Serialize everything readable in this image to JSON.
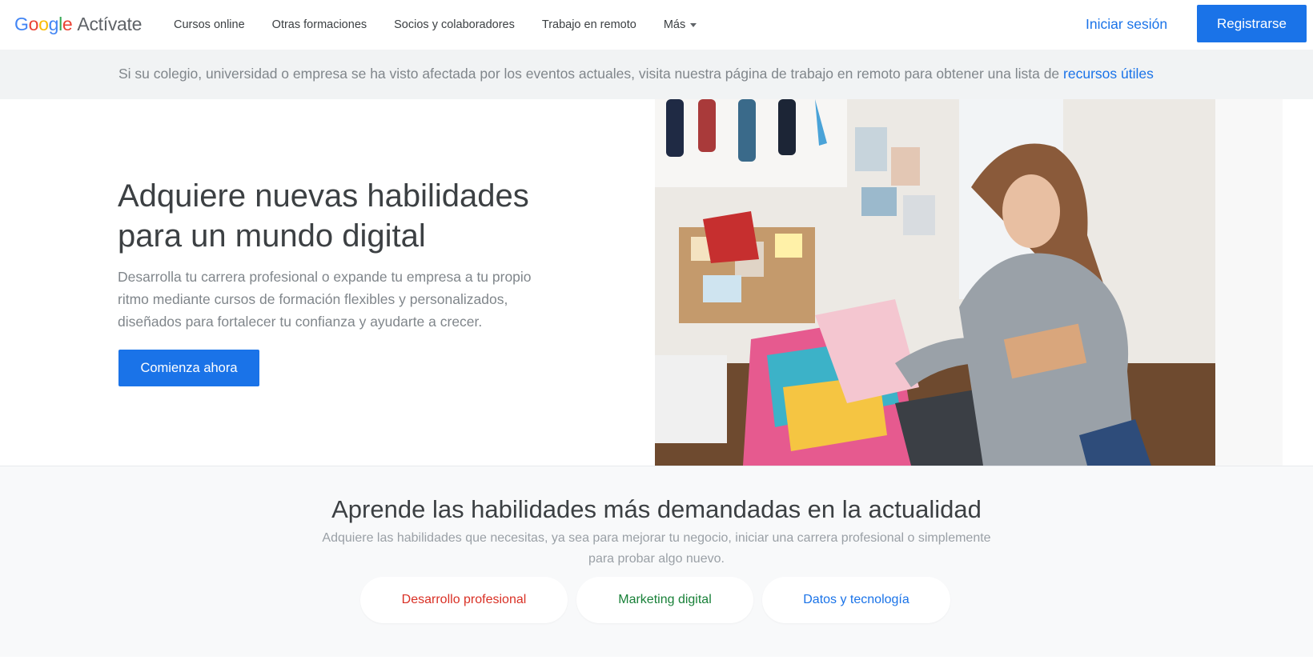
{
  "header": {
    "logo": {
      "g1": "G",
      "o1": "o",
      "o2": "o",
      "g2": "g",
      "l": "l",
      "e": "e",
      "product": "Actívate"
    },
    "nav": [
      "Cursos online",
      "Otras formaciones",
      "Socios y colaboradores",
      "Trabajo en remoto",
      "Más"
    ],
    "more_icon": "caret-down-icon",
    "login_label": "Iniciar sesión",
    "register_label": "Registrarse"
  },
  "notice": {
    "text": "Si su colegio, universidad o empresa se ha visto afectada por los eventos actuales, visita nuestra página de trabajo en remoto para obtener una lista de ",
    "link": "recursos útiles"
  },
  "hero": {
    "title": "Adquiere nuevas habilidades para un mundo digital",
    "description": "Desarrolla tu carrera profesional o expande tu empresa a tu propio ritmo mediante cursos de formación flexibles y personalizados, diseñados para fortalecer tu confianza y ayudarte a crecer.",
    "cta_label": "Comienza ahora"
  },
  "skills": {
    "title": "Aprende las habilidades más demandadas en la actualidad",
    "description": "Adquiere las habilidades que necesitas, ya sea para mejorar tu negocio, iniciar una carrera profesional o simplemente para probar algo nuevo.",
    "pills": [
      {
        "label": "Desarrollo profesional",
        "color": "#d93025"
      },
      {
        "label": "Marketing digital",
        "color": "#188038"
      },
      {
        "label": "Datos y tecnología",
        "color": "#1a73e8"
      }
    ]
  },
  "colors": {
    "brand_blue": "#1a73e8",
    "google_blue": "#4285f4",
    "google_red": "#ea4335",
    "google_yellow": "#fbbc05",
    "google_green": "#34a853"
  }
}
